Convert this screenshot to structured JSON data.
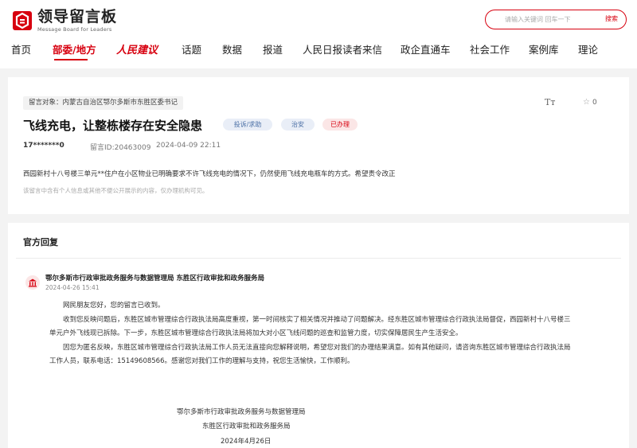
{
  "header": {
    "logo_cn": "领导留言板",
    "logo_en": "Message Board for Leaders",
    "search": {
      "placeholder": "请输入关键词 回车一下",
      "button": "搜索"
    },
    "nav": [
      {
        "label": "首页"
      },
      {
        "label": "部委/地方"
      },
      {
        "label": "人民建议"
      },
      {
        "label": "话题"
      },
      {
        "label": "数据"
      },
      {
        "label": "报道"
      },
      {
        "label": "人民日报读者来信"
      },
      {
        "label": "政企直通车"
      },
      {
        "label": "社会工作"
      },
      {
        "label": "案例库"
      },
      {
        "label": "理论"
      }
    ],
    "active_nav": "部委/地方",
    "accent_color": "#d7000f"
  },
  "message": {
    "target": "留言对象：内蒙古自治区鄂尔多斯市东胜区委书记",
    "title": "飞线充电，让整栋楼存在安全隐患",
    "tags": {
      "type": "投诉/求助",
      "area": "治安",
      "status": "已办理"
    },
    "font_toggle": "Tт",
    "favorites": "0",
    "user": "17*******0",
    "message_id": "留言ID:20463009",
    "time": "2024-04-09 22:11",
    "body": "西园新村十八号楼三单元**住户在小区物业已明确要求不许飞线充电的情况下，仍然使用飞线充电瓶车的方式。希望责令改正",
    "note": "该留言中含有个人信息或其他不便公开展示的内容，仅办理机构可见。"
  },
  "reply": {
    "heading": "官方回复",
    "org": "鄂尔多斯市行政审批政务服务与数据管理局 东胜区行政审批和政务服务局",
    "time": "2024-04-26 15:41",
    "paragraphs": [
      "网民朋友您好，您的留言已收到。",
      "收到您反映问题后，东胜区城市管理综合行政执法局高度重视，第一时间核实了相关情况并推动了问题解决。经东胜区城市管理综合行政执法局督促，西园新村十八号楼三单元户外飞线现已拆除。下一步，东胜区城市管理综合行政执法局将加大对小区飞线问题的巡查和监管力度，切实保障居民生产生活安全。",
      "因您为匿名反映，东胜区城市管理综合行政执法局工作人员无法直接向您解释说明，希望您对我们的办理结果满意。如有其他疑问，请咨询东胜区城市管理综合行政执法局工作人员，联系电话：15149608566。感谢您对我们工作的理解与支持，祝您生活愉快，工作顺利。"
    ],
    "signature": {
      "org1": "鄂尔多斯市行政审批政务服务与数据管理局",
      "org2": "东胜区行政审批和政务服务局",
      "date": "2024年4月26日"
    }
  }
}
